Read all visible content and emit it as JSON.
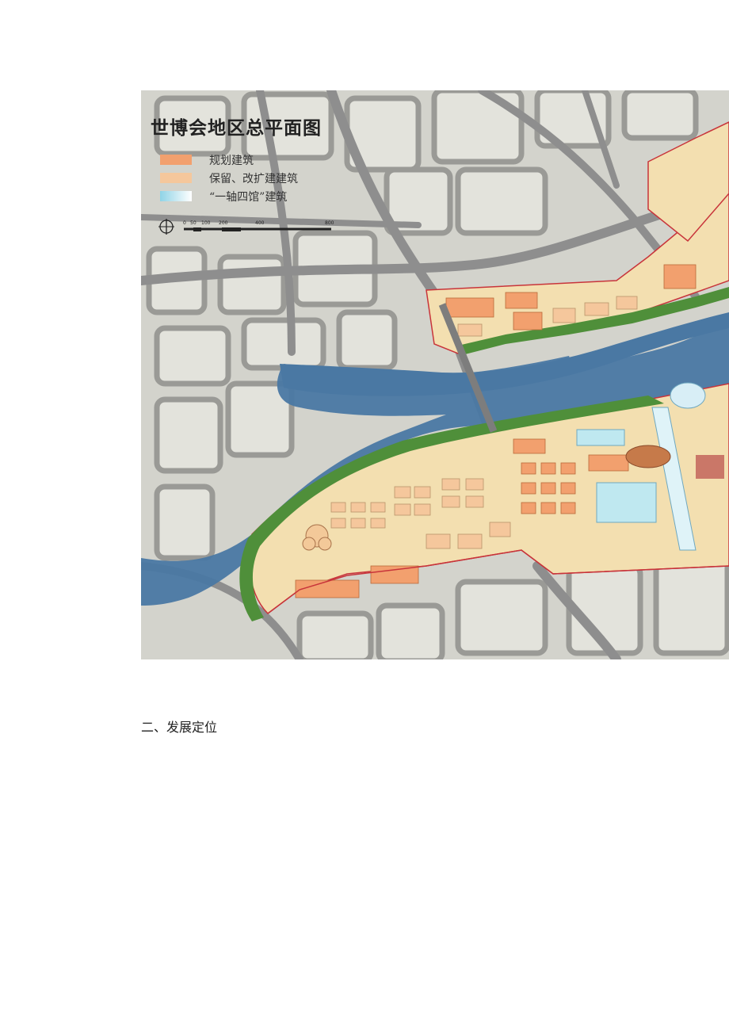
{
  "map": {
    "title": "世博会地区总平面图",
    "legend": [
      {
        "label": "规划建筑",
        "color": "#f2a06e"
      },
      {
        "label": "保留、改扩建建筑",
        "color": "#f5c79c"
      },
      {
        "label": "“一轴四馆”建筑",
        "color": "#bfe8f0"
      }
    ],
    "scale": {
      "ticks": [
        "0",
        "50",
        "100",
        "200",
        "400",
        "800"
      ],
      "icon": "north-arrow-icon"
    },
    "colors": {
      "river": "#4a78a3",
      "land": "#d3d3cc",
      "roads": "#8e8e8e",
      "site": "#f3dfb0",
      "green": "#4f8f3a",
      "boundary": "#c8343a"
    }
  },
  "section_heading": "二、发展定位"
}
